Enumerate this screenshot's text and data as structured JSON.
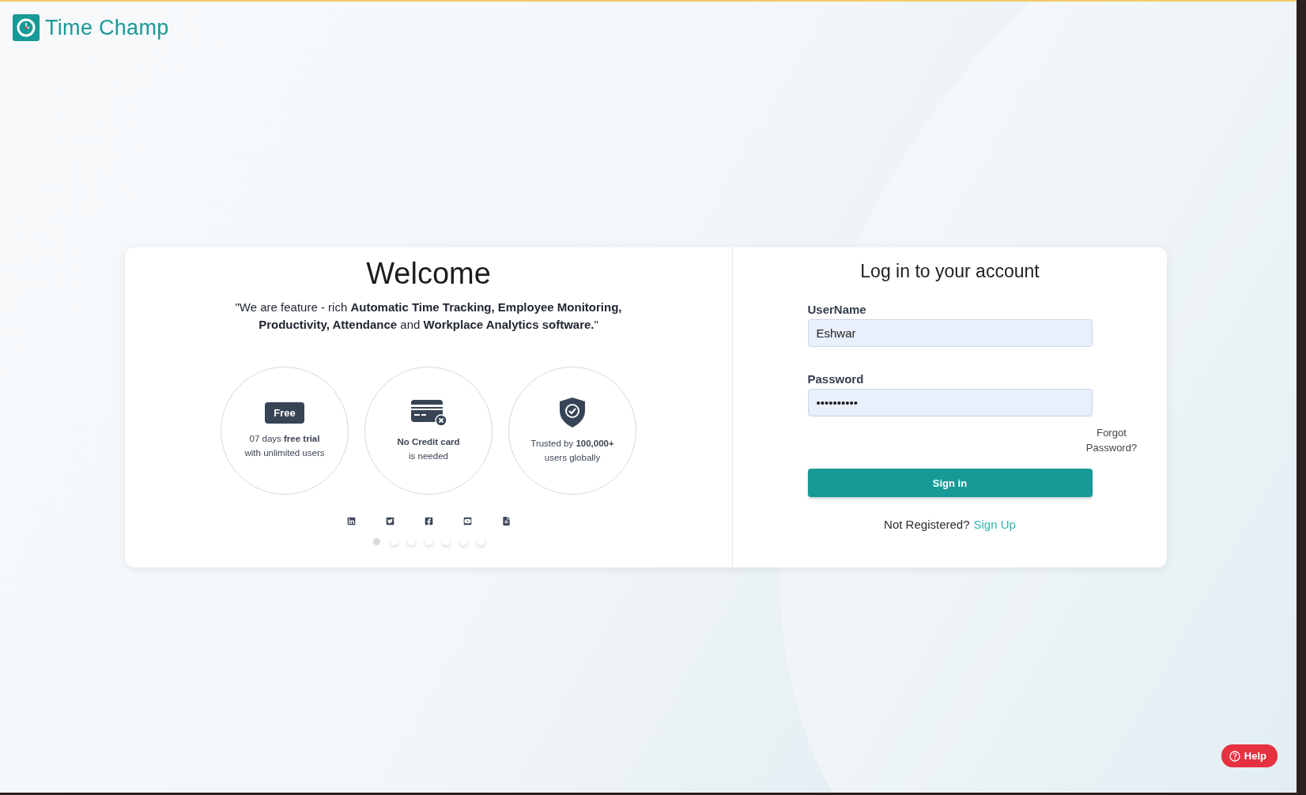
{
  "brand": {
    "name": "Time Champ"
  },
  "welcome": {
    "title": "Welcome",
    "quote": "\"We are feature - rich **Automatic Time Tracking, Employee Monitoring, Productivity, Attendance** and **Workplace Analytics software.**\"",
    "features": [
      {
        "kind": "badge",
        "badge": "Free",
        "lines": [
          "07 days **free trial**",
          "with unlimited users"
        ]
      },
      {
        "kind": "card",
        "lines": [
          "**No Credit card**",
          "is needed"
        ]
      },
      {
        "kind": "shield",
        "lines": [
          "Trusted by **100,000+**",
          "users globally"
        ]
      }
    ],
    "social": [
      {
        "kind": "linkedin"
      },
      {
        "kind": "twitter"
      },
      {
        "kind": "facebook"
      },
      {
        "kind": "youtube"
      },
      {
        "kind": "document"
      }
    ],
    "dots": [
      {
        "selected": true
      },
      {
        "selected": false
      },
      {
        "selected": false
      },
      {
        "selected": false
      },
      {
        "selected": false
      },
      {
        "selected": false
      },
      {
        "selected": false
      }
    ]
  },
  "login": {
    "title": "Log in to your account",
    "username": {
      "label": "UserName",
      "value": "Eshwar"
    },
    "password": {
      "label": "Password",
      "value": "••••••••••"
    },
    "forgot": "Forgot Password?",
    "submit": "Sign in",
    "register_prompt": "Not Registered?",
    "register_link": "Sign Up"
  },
  "help": {
    "label": "Help"
  }
}
